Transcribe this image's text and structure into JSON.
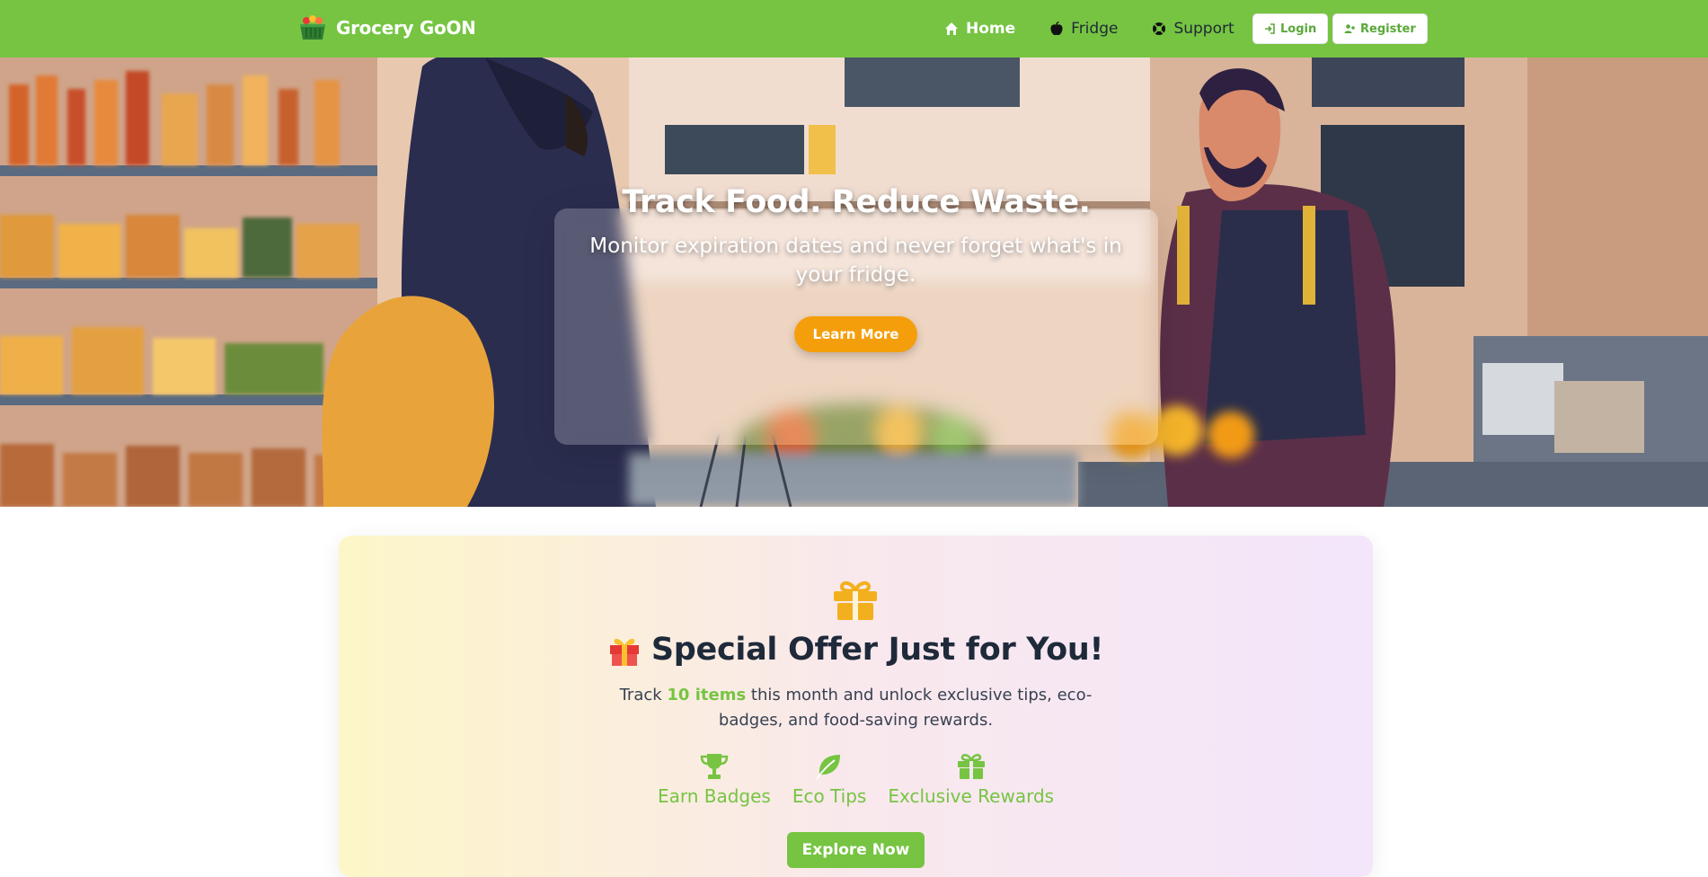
{
  "navbar": {
    "brand": "Grocery GoON",
    "links": [
      {
        "label": "Home",
        "icon": "home-icon",
        "active": true
      },
      {
        "label": "Fridge",
        "icon": "apple-icon",
        "active": false
      },
      {
        "label": "Support",
        "icon": "lifebuoy-icon",
        "active": false
      }
    ],
    "login_label": "Login",
    "register_label": "Register"
  },
  "hero": {
    "title": "Track Food. Reduce Waste.",
    "subtitle": "Monitor expiration dates and never forget what's in your fridge.",
    "cta_label": "Learn More"
  },
  "offer": {
    "title": "Special Offer Just for You!",
    "text_before": "Track ",
    "text_highlight": "10 items",
    "text_after": " this month and unlock exclusive tips, eco-badges, and food-saving rewards.",
    "features": [
      {
        "label": "Earn Badges",
        "icon": "trophy-icon"
      },
      {
        "label": "Eco Tips",
        "icon": "leaf-icon"
      },
      {
        "label": "Exclusive Rewards",
        "icon": "gift-icon"
      }
    ],
    "cta_label": "Explore Now"
  },
  "colors": {
    "brand_green": "#76c442",
    "accent_orange": "#f59e0b",
    "gift_yellow": "#f2b01e",
    "heading_dark": "#1e2a3a"
  }
}
